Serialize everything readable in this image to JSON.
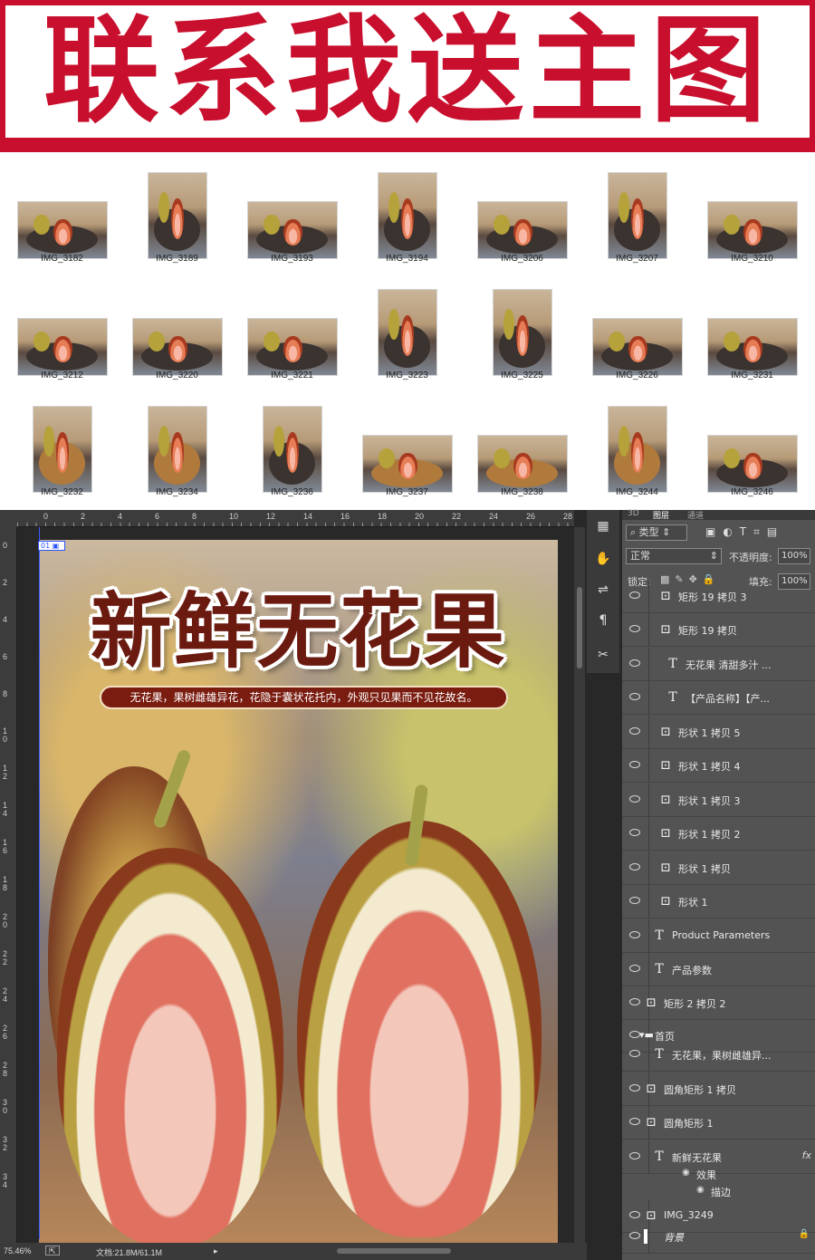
{
  "banner": {
    "text": "联系我送主图",
    "colors": {
      "red": "#c8102e"
    }
  },
  "gallery": {
    "files": [
      "IMG_3182",
      "IMG_3189",
      "IMG_3193",
      "IMG_3194",
      "IMG_3206",
      "IMG_3207",
      "IMG_3210",
      "IMG_3212",
      "IMG_3220",
      "IMG_3221",
      "IMG_3223",
      "IMG_3225",
      "IMG_3226",
      "IMG_3231",
      "IMG_3232",
      "IMG_3234",
      "IMG_3236",
      "IMG_3237",
      "IMG_3238",
      "IMG_3244",
      "IMG_3246"
    ]
  },
  "photoshop": {
    "ruler_top": [
      "0",
      "2",
      "4",
      "6",
      "8",
      "10",
      "12",
      "14",
      "16",
      "18",
      "20",
      "22",
      "24",
      "26",
      "28"
    ],
    "ruler_left": [
      "0",
      "2",
      "4",
      "6",
      "8",
      "1 0",
      "1 2",
      "1 4",
      "1 6",
      "1 8",
      "2 0",
      "2 2",
      "2 4",
      "2 6",
      "2 8",
      "3 0",
      "3 2",
      "3 4"
    ],
    "artboard_tag": "01",
    "canvas": {
      "title": "新鲜无花果",
      "subtitle": "无花果，果树雌雄异花，花隐于囊状花托内，外观只见果而不见花故名。"
    },
    "status": {
      "zoom": "75.46%",
      "doc": "文档:21.8M/61.1M"
    },
    "layers_panel": {
      "tabs": [
        "3D",
        "图层",
        "通道"
      ],
      "filter_kind": "类型",
      "blend_mode": "正常",
      "opacity_label": "不透明度:",
      "opacity_value": "100%",
      "lock_label": "锁定:",
      "fill_label": "填充:",
      "fill_value": "100%",
      "layers": [
        {
          "name": "矩形 19 拷贝 3",
          "kind": "shape"
        },
        {
          "name": "矩形 19 拷贝",
          "kind": "shape"
        },
        {
          "name": "无花果 清甜多汁 ...",
          "kind": "text"
        },
        {
          "name": "【产品名称】【产...",
          "kind": "text"
        },
        {
          "name": "形状 1 拷贝 5",
          "kind": "shape"
        },
        {
          "name": "形状 1 拷贝 4",
          "kind": "shape"
        },
        {
          "name": "形状 1 拷贝 3",
          "kind": "shape"
        },
        {
          "name": "形状 1 拷贝 2",
          "kind": "shape"
        },
        {
          "name": "形状 1 拷贝",
          "kind": "shape"
        },
        {
          "name": "形状 1",
          "kind": "shape"
        },
        {
          "name": "Product Parameters",
          "kind": "text"
        },
        {
          "name": "产品参数",
          "kind": "text"
        },
        {
          "name": "矩形 2 拷贝 2",
          "kind": "shape"
        },
        {
          "name": "首页",
          "kind": "group"
        },
        {
          "name": "无花果，果树雌雄异...",
          "kind": "text"
        },
        {
          "name": "圆角矩形 1 拷贝",
          "kind": "shape"
        },
        {
          "name": "圆角矩形 1",
          "kind": "shape"
        },
        {
          "name": "新鲜无花果",
          "kind": "text",
          "fx": "fx"
        },
        {
          "name": "效果",
          "kind": "effect"
        },
        {
          "name": "描边",
          "kind": "effect"
        },
        {
          "name": "IMG_3249",
          "kind": "smart"
        },
        {
          "name": "背景",
          "kind": "background"
        }
      ]
    }
  }
}
